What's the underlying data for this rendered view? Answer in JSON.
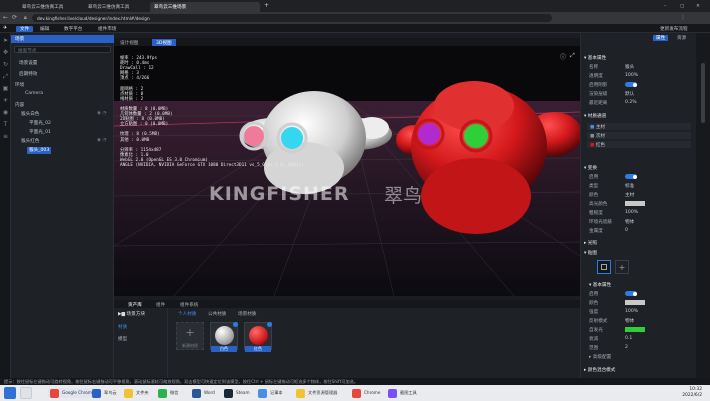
{
  "browser": {
    "tabs": [
      {
        "label": "翠鸟云三维仿真工具",
        "active": false
      },
      {
        "label": "翠鸟云三维仿真工具",
        "active": false
      },
      {
        "label": "翠鸟云三维场景",
        "active": true
      }
    ],
    "new_tab": "+",
    "url": "dev.kingfisher.live/cloud/designer/index.html#/design",
    "window_controls": [
      "–",
      "▢",
      "✕"
    ]
  },
  "menu": {
    "items": [
      "文件",
      "编辑",
      "数字平台",
      "组件市场"
    ],
    "active": 0,
    "right": "更新发布流程"
  },
  "tree": {
    "header": "场景",
    "search_placeholder": "搜索节点",
    "nodes": [
      {
        "label": "场景设置",
        "indent": 1
      },
      {
        "label": "后期特效",
        "indent": 1
      },
      {
        "label": "环境",
        "indent": 0
      },
      {
        "label": "Camera",
        "indent": 2
      },
      {
        "label": "内容",
        "indent": 0
      },
      {
        "label": "猴头白色",
        "indent": 1
      },
      {
        "label": "平面光_02",
        "indent": 2
      },
      {
        "label": "平面光_01",
        "indent": 2
      },
      {
        "label": "猴头红色",
        "indent": 1
      },
      {
        "label": "猴头_003",
        "indent": 2,
        "selected": true
      }
    ]
  },
  "viewport": {
    "tabs": [
      "设计视图",
      "3D视图"
    ],
    "active_tab": 1,
    "stats": [
      "帧率 : 243.9fps",
      "耗时 : 0.4ms",
      "DrawCall : 12",
      "网格 : 3",
      "顶点 : 4/266",
      "",
      "面网格 : 2",
      "点材质 : 8",
      "线材质 : 2",
      "",
      "材质数量 : 8 (0.0MB)",
      "几何体数量 : 2 (0.0MB)",
      "2D贴图 : 8 (0.0MB)",
      "立方贴图 : 0 (0.0MB)",
      "",
      "纹理 : 8 (0.5MB)",
      "其他 : 0.0MB",
      "",
      "分辨率 : 1154x487",
      "像素比 : 1.0",
      "WebGL 2.0 (OpenGL ES 3.0 Chromium)",
      "ANGLE (NVIDIA, NVIDIA GeForce GTX 1080 Direct3D11 vs_5_0 ps_5_0, D3D11)"
    ],
    "watermark": "KINGFISHER",
    "watermark_cn": "翠鸟"
  },
  "assets": {
    "tabs": [
      "资产库",
      "组件",
      "组件系统"
    ],
    "active_tab": 0,
    "folder": "场景方块",
    "categories": [
      "材质",
      "模型"
    ],
    "subtabs": [
      "个人材质",
      "公共材质",
      "场景材质"
    ],
    "add_label": "新建材质",
    "items": [
      {
        "label": "白色"
      },
      {
        "label": "红色"
      }
    ]
  },
  "props": {
    "tabs": [
      "属性",
      "资源"
    ],
    "section1": "基本属性",
    "rows1": [
      {
        "label": "名称",
        "value": "猴头"
      },
      {
        "label": "透明度",
        "value": "100%"
      },
      {
        "label": "启用阴影",
        "value": "toggle"
      },
      {
        "label": "渲染层级",
        "value": "默认"
      },
      {
        "label": "最近距离",
        "value": "0.2%"
      }
    ],
    "section2": "材质通道",
    "materials": [
      "主材",
      "次材",
      "红色"
    ],
    "section3": "变换",
    "rows3": [
      {
        "label": "启用",
        "value": "toggle"
      },
      {
        "label": "类型",
        "value": "标准"
      },
      {
        "label": "颜色",
        "value": "主材"
      },
      {
        "label": "高光颜色",
        "value": ""
      },
      {
        "label": "粗糙度",
        "value": "100%"
      },
      {
        "label": "环境光遮蔽",
        "value": "物体"
      },
      {
        "label": "金属度",
        "value": "0"
      }
    ],
    "section4": "光照",
    "section5": "贴图",
    "section6": "基本属性",
    "rows6": [
      {
        "label": "启用",
        "value": "toggle"
      },
      {
        "label": "颜色",
        "value": ""
      },
      {
        "label": "强度",
        "value": "100%"
      },
      {
        "label": "反射模式",
        "value": "物体"
      },
      {
        "label": "自发光",
        "value": ""
      },
      {
        "label": "衰减",
        "value": "0.1"
      },
      {
        "label": "范围",
        "value": "2"
      },
      {
        "label": "高级配置",
        "value": ""
      }
    ],
    "section7": "颜色混合模式"
  },
  "status": "提示：按住鼠标左键拖动可旋转视角，按住鼠标右键拖动可平移视角，滚动鼠标滚轮可缩放视角，双击模型可快速定位到该模型，按住Ctrl + 鼠标左键拖动可框选多个物体，按住Shift可加选。",
  "taskbar": {
    "apps": [
      "Google Chrome",
      "翠鸟云",
      "文件夹",
      "微信",
      "Word",
      "Steam",
      "记事本",
      "文件资源管理器",
      "Chrome",
      "截图工具"
    ],
    "time": "10:32",
    "date": "2022/6/2"
  },
  "colors": {
    "accent": "#2962c4",
    "monkey_white": "#e4e4e4",
    "monkey_red": "#d3181b",
    "eye_pink": "#f07a9a",
    "eye_cyan": "#35d6f0",
    "eye_purple": "#b02ad0",
    "eye_green": "#2fcf3a"
  }
}
